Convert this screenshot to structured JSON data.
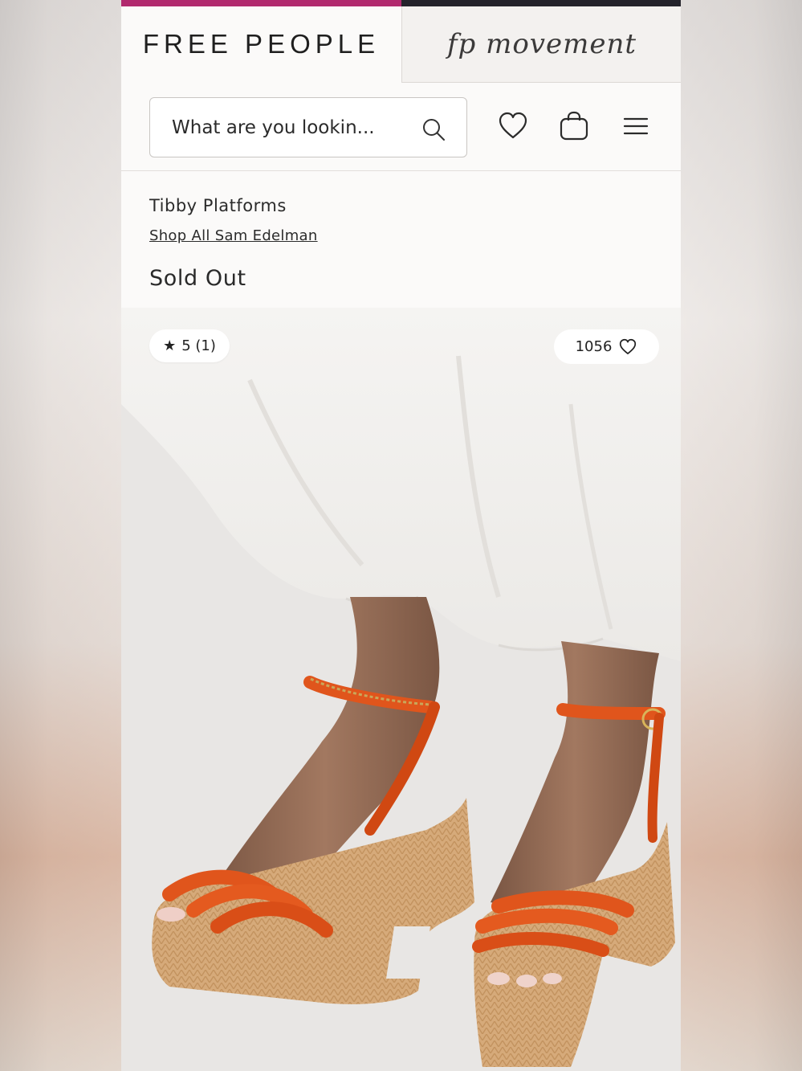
{
  "header": {
    "brand_name": "FREE PEOPLE",
    "secondary_brand": "fp movement"
  },
  "search": {
    "placeholder": "What are you lookin..."
  },
  "icons": {
    "search": "search-icon",
    "wishlist": "heart-icon",
    "bag": "shopping-bag-icon",
    "menu": "hamburger-menu-icon"
  },
  "product": {
    "title": "Tibby Platforms",
    "brand_link": "Shop All Sam Edelman",
    "status": "Sold Out",
    "rating_star": "★",
    "rating": "5 (1)",
    "likes": "1056"
  },
  "colors": {
    "accent": "#b1296e",
    "topbar": "#24232b",
    "strap": "#e0551c",
    "platform": "#d2a676"
  }
}
